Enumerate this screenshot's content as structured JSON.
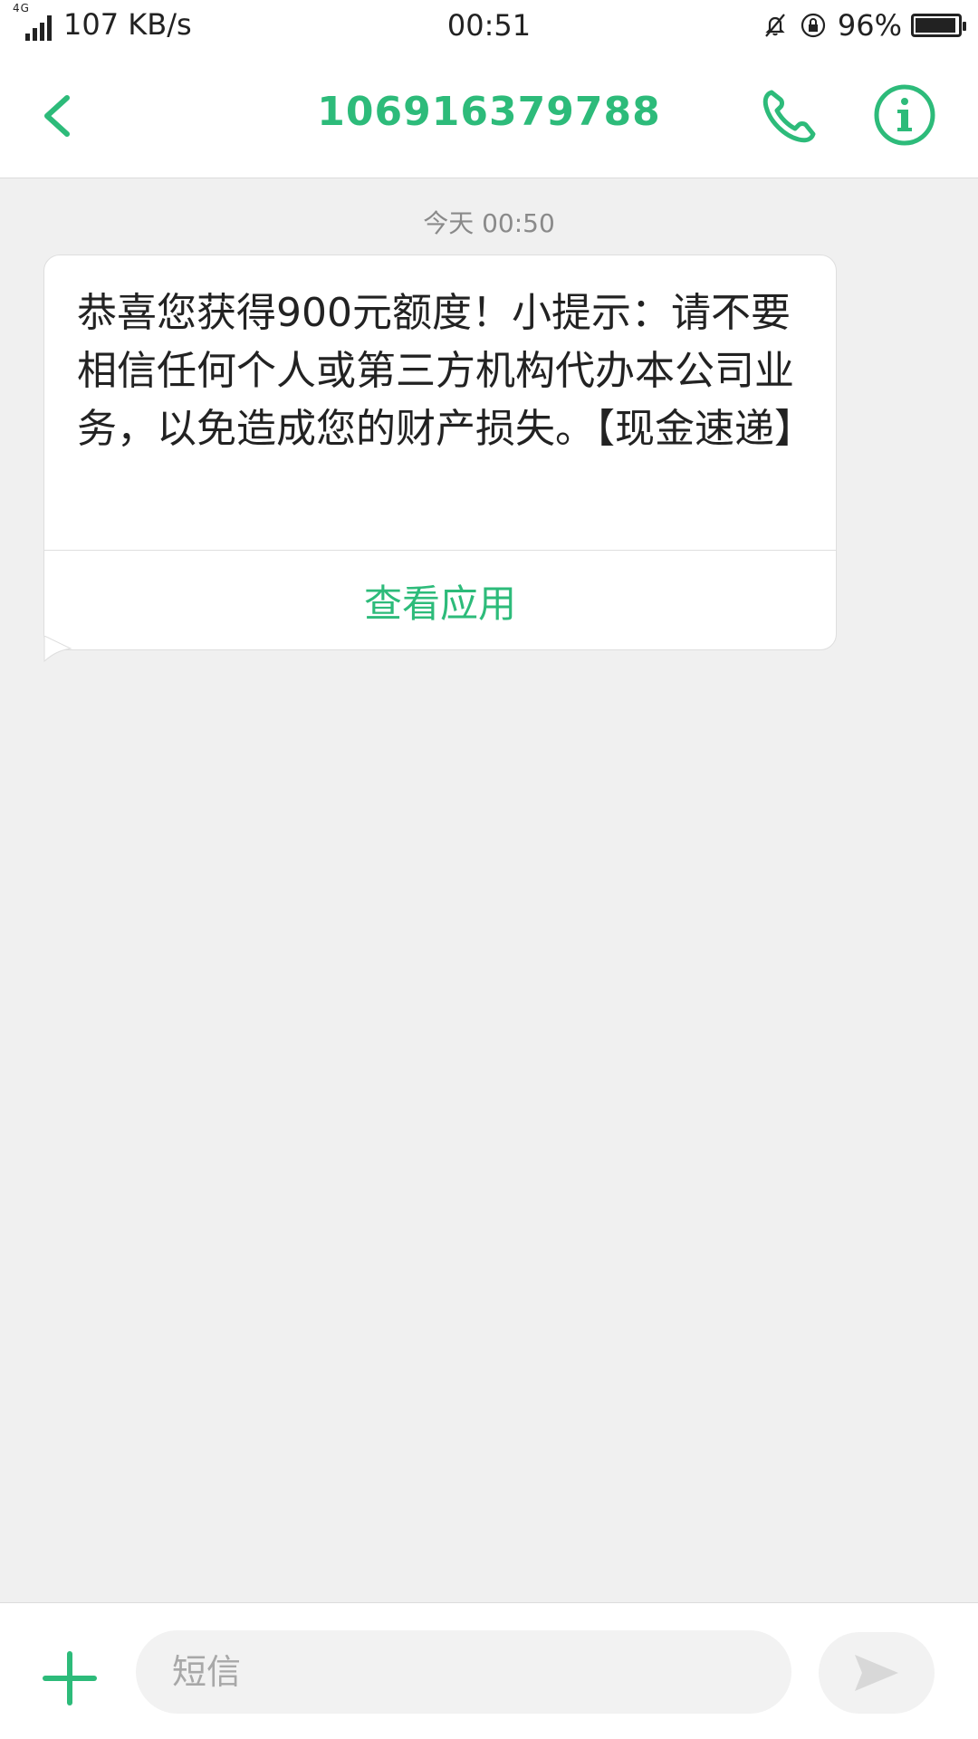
{
  "status_bar": {
    "network": "4G",
    "speed": "107 KB/s",
    "time": "00:51",
    "battery": "96%",
    "battery_level": 0.96
  },
  "header": {
    "title": "106916379788",
    "back_icon": "chevron-left-icon",
    "call_icon": "phone-icon",
    "info_icon": "info-icon"
  },
  "thread": {
    "timestamp": "今天 00:50",
    "message": {
      "text": "恭喜您获得900元额度！小提示：请不要相信任何个人或第三方机构代办本公司业务，以免造成您的财产损失。【现金速递】",
      "action_label": "查看应用"
    }
  },
  "composer": {
    "placeholder": "短信",
    "add_icon": "plus-icon",
    "send_icon": "send-icon"
  },
  "colors": {
    "accent": "#2dbb7a",
    "background": "#f0f0f0",
    "bubble": "#ffffff"
  }
}
